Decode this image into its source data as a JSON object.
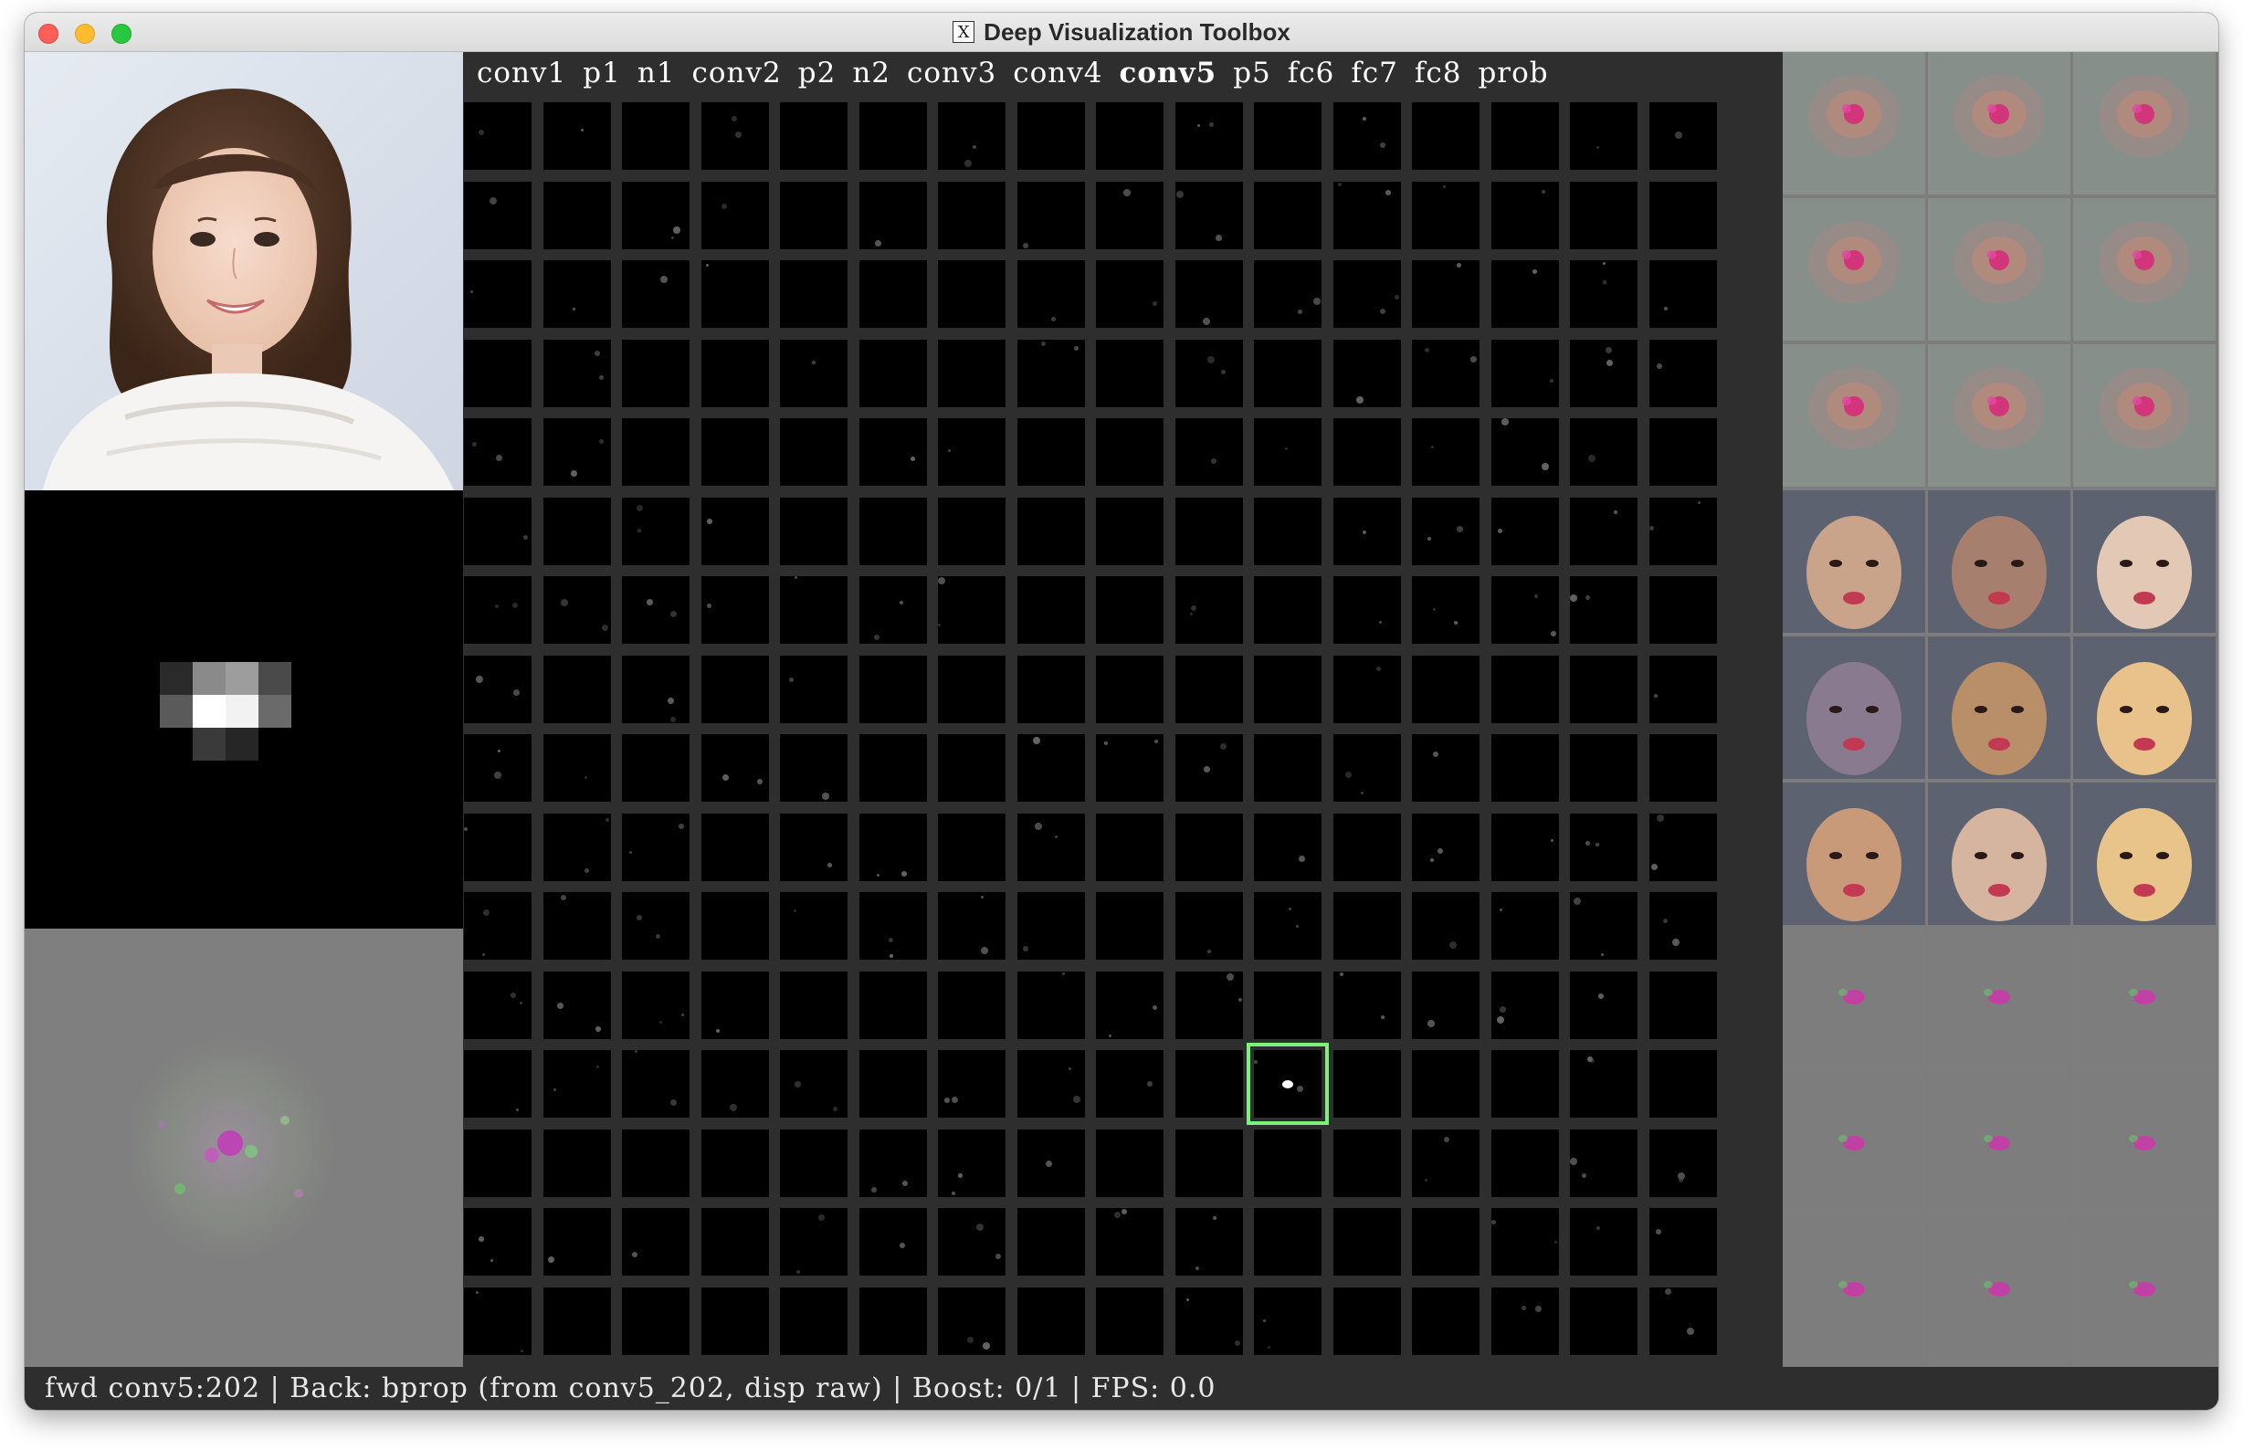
{
  "window": {
    "title": "Deep Visualization Toolbox"
  },
  "layers": [
    {
      "label": "conv1",
      "active": false
    },
    {
      "label": "p1",
      "active": false
    },
    {
      "label": "n1",
      "active": false
    },
    {
      "label": "conv2",
      "active": false
    },
    {
      "label": "p2",
      "active": false
    },
    {
      "label": "n2",
      "active": false
    },
    {
      "label": "conv3",
      "active": false
    },
    {
      "label": "conv4",
      "active": false
    },
    {
      "label": "conv5",
      "active": true
    },
    {
      "label": "p5",
      "active": false
    },
    {
      "label": "fc6",
      "active": false
    },
    {
      "label": "fc7",
      "active": false
    },
    {
      "label": "fc8",
      "active": false
    },
    {
      "label": "prob",
      "active": false
    }
  ],
  "unit_grid": {
    "columns": 16,
    "rows": 16,
    "selected_index": 202
  },
  "right_panel": {
    "rows": [
      {
        "kind": "optimized-image"
      },
      {
        "kind": "optimized-image"
      },
      {
        "kind": "optimized-image"
      },
      {
        "kind": "top-image"
      },
      {
        "kind": "top-image"
      },
      {
        "kind": "top-image"
      },
      {
        "kind": "deconv-image"
      },
      {
        "kind": "deconv-image"
      },
      {
        "kind": "deconv-image"
      }
    ]
  },
  "status": {
    "text": "fwd conv5:202 | Back: bprop (from conv5_202, disp raw) | Boost: 0/1 | FPS: 0.0"
  },
  "colors": {
    "selection": "#7cf27c",
    "panel_bg": "#2e2e2e",
    "text": "#ffffff"
  }
}
